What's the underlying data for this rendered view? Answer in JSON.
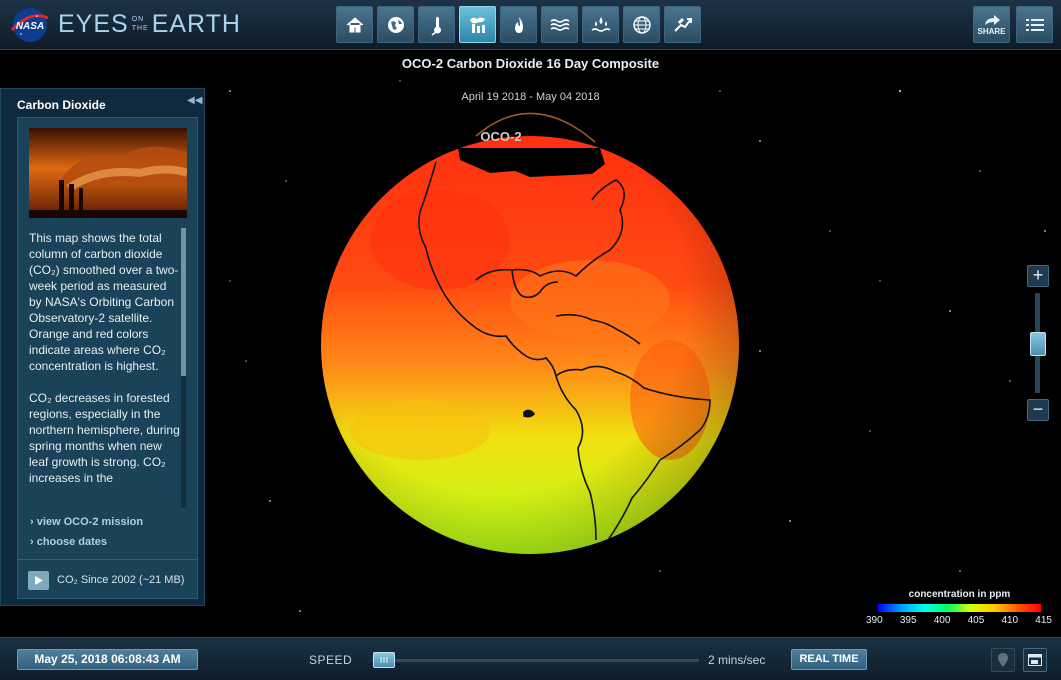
{
  "header": {
    "nasa_logo_text": "NASA",
    "brand_left": "EYES",
    "brand_small_top": "ON",
    "brand_small_bottom": "THE",
    "brand_right": "EARTH",
    "nav_icons": [
      "home-icon",
      "globe-icon",
      "thermometer-icon",
      "factory-icon",
      "fire-icon",
      "waves-icon",
      "water-drops-icon",
      "earth-grid-icon",
      "satellite-icon"
    ],
    "active_nav_index": 3,
    "share_label": "SHARE",
    "menu_icon": "list-icon"
  },
  "stage": {
    "title": "OCO-2 Carbon Dioxide 16 Day Composite",
    "date_range": "April 19 2018 - May 04 2018",
    "satellite_label": "OCO-2"
  },
  "side_panel": {
    "title": "Carbon Dioxide",
    "collapse_icon": "double-chevron-left-icon",
    "description_p1": "This map shows the total column of carbon dioxide (CO₂) smoothed over a two-week period as measured by NASA's Orbiting Carbon Observatory-2 satellite. Orange and red colors indicate areas where CO₂ concentration is highest.",
    "description_p2": "CO₂ decreases in forested regions, especially in the northern hemisphere, during spring months when new leaf growth is strong. CO₂ increases in the",
    "link_mission": "› view OCO-2 mission",
    "link_dates": "› choose dates",
    "download_label": "CO₂ Since 2002 (~21 MB)"
  },
  "zoom": {
    "plus": "+",
    "minus": "−",
    "level": 0.56
  },
  "legend": {
    "title": "concentration in ppm",
    "ticks": [
      "390",
      "395",
      "400",
      "405",
      "410",
      "415"
    ],
    "colors": [
      "#0000ff",
      "#00ffee",
      "#d8ff00",
      "#ff0000"
    ]
  },
  "bottom_bar": {
    "datetime": "May 25, 2018 06:08:43 AM",
    "speed_label": "SPEED",
    "speed_value": "2 mins/sec",
    "speed_level": 0.03,
    "realtime_label": "REAL TIME"
  }
}
